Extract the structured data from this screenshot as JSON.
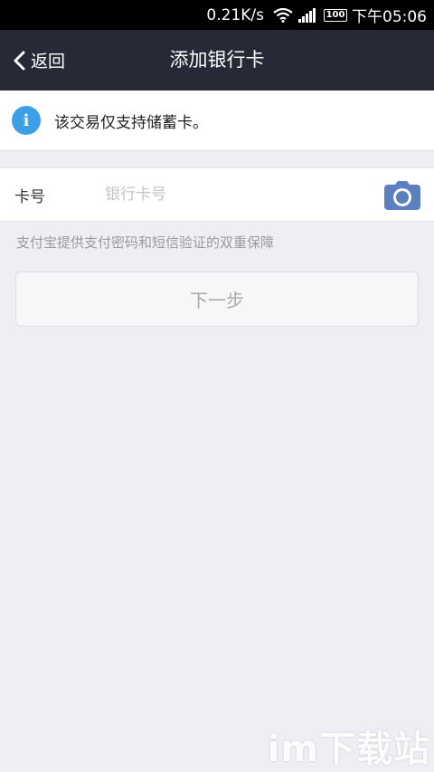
{
  "status_bar": {
    "speed": "0.21K/s",
    "battery": "100",
    "time": "下午05:06"
  },
  "nav": {
    "back_label": "返回",
    "title": "添加银行卡",
    "background": "#252a36"
  },
  "notice": {
    "icon": "info-icon",
    "text": "该交易仅支持储蓄卡。",
    "icon_color": "#3d9fe8"
  },
  "card_form": {
    "label": "卡号",
    "value": "",
    "placeholder": "银行卡号",
    "camera_icon": "camera-icon",
    "camera_color": "#5b7fbf"
  },
  "hint": "支付宝提供支付密码和短信验证的双重保障",
  "next_button": {
    "label": "下一步"
  },
  "watermark": "im下载站"
}
